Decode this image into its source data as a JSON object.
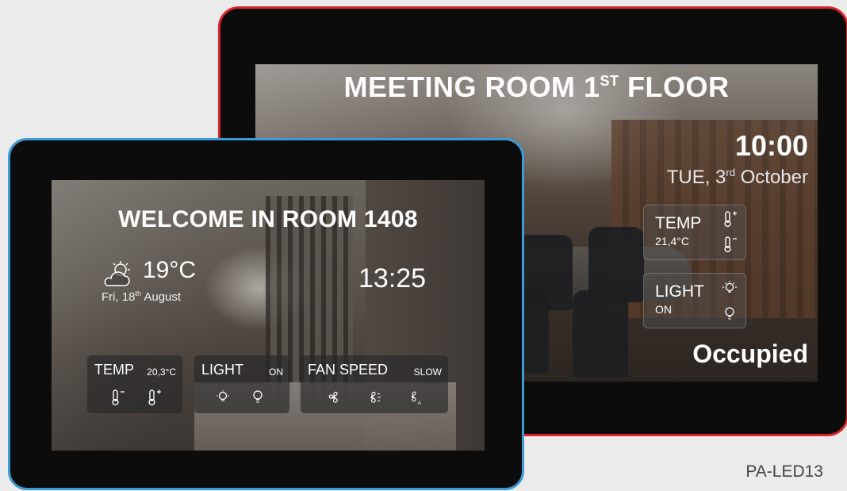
{
  "meeting_panel": {
    "title_main": "MEETING ROOM 1",
    "title_ordinal": "ST",
    "title_end": " FLOOR",
    "time": "10:00",
    "date_prefix": "TUE, 3",
    "date_ordinal": "rd",
    "date_suffix": " October",
    "temp_label": "TEMP",
    "temp_value": "21,4°C",
    "light_label": "LIGHT",
    "light_value": "ON",
    "status": "Occupied",
    "frame_color": "#d8252b"
  },
  "hotel_panel": {
    "title": "WELCOME IN ROOM 1408",
    "weather_icon": "partly-cloudy-icon",
    "temperature": "19°C",
    "date_prefix": "Fri, 18",
    "date_ordinal": "th",
    "date_suffix": " August",
    "time": "13:25",
    "temp_tile": {
      "label": "TEMP",
      "value": "20,3°C",
      "icons": [
        "thermometer-minus-icon",
        "thermometer-plus-icon"
      ]
    },
    "light_tile": {
      "label": "LIGHT",
      "value": "ON",
      "icons": [
        "bulb-dim-icon",
        "bulb-icon"
      ]
    },
    "fan_tile": {
      "label": "FAN SPEED",
      "value": "SLOW",
      "icons": [
        "fan-icon",
        "fan-speed-icon",
        "fan-auto-icon"
      ]
    },
    "frame_color": "#3b9bd6"
  },
  "model_label": "PA-LED13"
}
